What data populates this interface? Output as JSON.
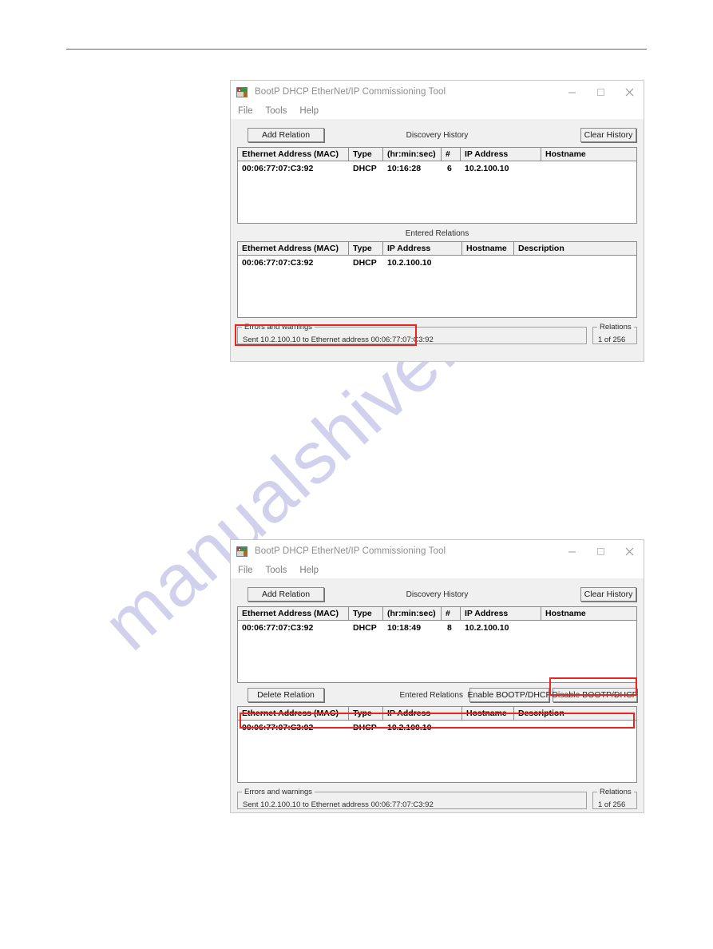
{
  "page": {
    "watermark": "manualshive.com",
    "rule_color": "#1f7f96"
  },
  "accent": {
    "annotation_red": "#e8251f",
    "window_bg": "#f0f0f0",
    "grid_bg": "#ffffff"
  },
  "window": {
    "title": "BootP DHCP EtherNet/IP Commissioning Tool",
    "icon": "app-icon",
    "controls": {
      "minimize": "minimize-icon",
      "maximize": "maximize-icon",
      "close": "close-icon"
    },
    "menu": [
      "File",
      "Tools",
      "Help"
    ]
  },
  "labels": {
    "add_relation": "Add Relation",
    "clear_history": "Clear History",
    "discovery_history": "Discovery History",
    "entered_relations": "Entered Relations",
    "delete_relation": "Delete Relation",
    "enable_bootp": "Enable BOOTP/DHCP",
    "disable_bootp": "Disable BOOTP/DHCP",
    "errors_legend": "Errors and warnings",
    "relations_legend": "Relations"
  },
  "discovery_table": {
    "columns": [
      "Ethernet Address (MAC)",
      "Type",
      "(hr:min:sec)",
      "#",
      "IP Address",
      "Hostname"
    ]
  },
  "entered_table": {
    "columns": [
      "Ethernet Address (MAC)",
      "Type",
      "IP Address",
      "Hostname",
      "Description"
    ]
  },
  "window1": {
    "discovery_rows": [
      {
        "mac": "00:06:77:07:C3:92",
        "type": "DHCP",
        "time": "10:16:28",
        "count": "6",
        "ip": "10.2.100.10",
        "hostname": ""
      }
    ],
    "entered_rows": [
      {
        "mac": "00:06:77:07:C3:92",
        "type": "DHCP",
        "ip": "10.2.100.10",
        "hostname": "",
        "description": ""
      }
    ],
    "status": {
      "error_text": "Sent 10.2.100.10 to Ethernet address 00:06:77:07:C3:92",
      "relations_count": "1 of 256"
    }
  },
  "window2": {
    "discovery_rows": [
      {
        "mac": "00:06:77:07:C3:92",
        "type": "DHCP",
        "time": "10:18:49",
        "count": "8",
        "ip": "10.2.100.10",
        "hostname": ""
      }
    ],
    "entered_rows": [
      {
        "mac": "00:06:77:07:C3:92",
        "type": "DHCP",
        "ip": "10.2.100.10",
        "hostname": "",
        "description": ""
      }
    ],
    "status": {
      "error_text": "Sent 10.2.100.10 to Ethernet address 00:06:77:07:C3:92",
      "relations_count": "1 of 256"
    }
  }
}
